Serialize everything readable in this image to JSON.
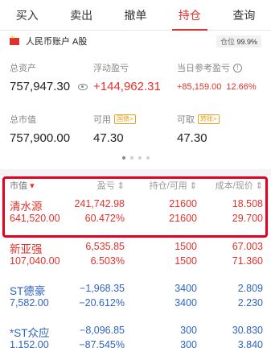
{
  "tabs": [
    "买入",
    "卖出",
    "撤单",
    "持仓",
    "查询"
  ],
  "account": {
    "name": "人民币账户 A股",
    "position_label": "仓位",
    "position_value": "99.9%"
  },
  "summary": {
    "total_assets_label": "总资产",
    "total_assets": "757,947.30",
    "float_pl_label": "浮动盈亏",
    "float_pl": "+144,962.31",
    "today_pl_label": "当日参考盈亏",
    "today_pl": "+85,159.00",
    "today_pl_pct": "12.66%",
    "market_value_label": "总市值",
    "market_value": "757,900.00",
    "available_label": "可用",
    "available_tag": "国债>",
    "available": "47.30",
    "withdrawable_label": "可取",
    "withdrawable_tag": "转账>",
    "withdrawable": "47.30"
  },
  "table": {
    "headers": {
      "name": "市值",
      "pl": "盈亏",
      "pos": "持仓/可用",
      "cost": "成本/现价"
    },
    "rows": [
      {
        "name": "清水源",
        "market_value": "641,520.00",
        "pl": "241,742.98",
        "pl_pct": "60.472%",
        "hold": "21600",
        "avail": "21600",
        "cost": "18.508",
        "price": "29.700",
        "color": "#e0322b"
      },
      {
        "name": "新亚强",
        "market_value": "107,040.00",
        "pl": "6,535.85",
        "pl_pct": "6.503%",
        "hold": "1500",
        "avail": "1500",
        "cost": "67.003",
        "price": "71.360",
        "color": "#e0322b"
      },
      {
        "name": "ST德豪",
        "market_value": "7,582.00",
        "pl": "−1,968.35",
        "pl_pct": "−20.612%",
        "hold": "3400",
        "avail": "3400",
        "cost": "2.809",
        "price": "2.230",
        "color": "#2f64c2"
      },
      {
        "name": "*ST众应",
        "market_value": "1,152.00",
        "pl": "−8,096.85",
        "pl_pct": "−87.545%",
        "hold": "300",
        "avail": "300",
        "cost": "30.830",
        "price": "3.840",
        "color": "#2f64c2"
      }
    ]
  },
  "colors": {
    "accent": "#e0322b",
    "loss": "#2f64c2",
    "highlight": "#e5001f"
  }
}
